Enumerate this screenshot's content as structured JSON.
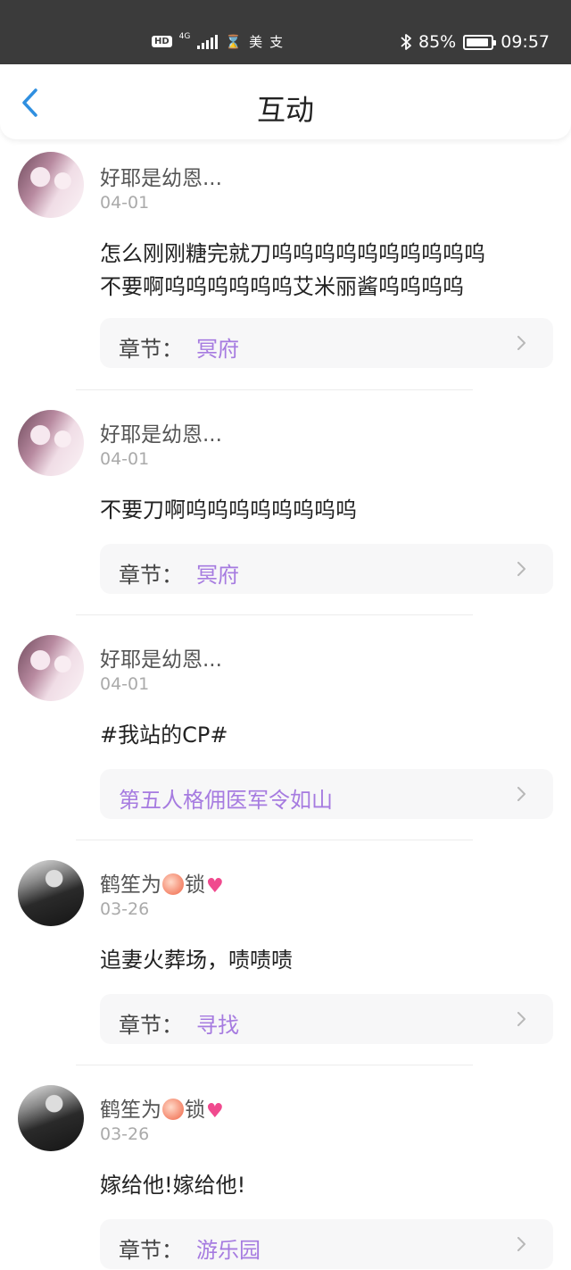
{
  "status_bar": {
    "left_badge": "HD",
    "network": "4G",
    "app_glyph_1": "⌛",
    "app_glyph_2": "美",
    "app_glyph_3": "支",
    "bluetooth": "✱",
    "battery_text": "85%",
    "time": "09:57",
    "battery_level": 0.85
  },
  "header": {
    "title": "互动",
    "back_icon": "chevron-left-icon"
  },
  "comments": [
    {
      "username": "好耶是幼恩...",
      "date": "04-01",
      "text_lines": [
        "怎么刚刚糖完就刀呜呜呜呜呜呜呜呜呜呜",
        "不要啊呜呜呜呜呜呜艾米丽酱呜呜呜呜"
      ],
      "chapter_label": "章节：",
      "chapter_value": "冥府"
    },
    {
      "username": "好耶是幼恩...",
      "date": "04-01",
      "text_lines": [
        "不要刀啊呜呜呜呜呜呜呜呜"
      ],
      "chapter_label": "章节：",
      "chapter_value": "冥府"
    },
    {
      "username": "好耶是幼恩...",
      "date": "04-01",
      "text_lines": [
        "#我站的CP#"
      ],
      "chapter_label": "",
      "chapter_value": "第五人格佣医军令如山"
    },
    {
      "username": "鹤笙为",
      "username_suffix": "锁",
      "date": "03-26",
      "text_lines": [
        "追妻火葬场，啧啧啧"
      ],
      "chapter_label": "章节：",
      "chapter_value": "寻找"
    },
    {
      "username": "鹤笙为",
      "username_suffix": "锁",
      "date": "03-26",
      "text_lines": [
        "嫁给他!嫁给他!"
      ],
      "chapter_label": "章节：",
      "chapter_value": "游乐园"
    }
  ],
  "colors": {
    "status_bar_bg": "#3b3b3b",
    "accent_purple": "#a67be0",
    "back_arrow_blue": "#2f8fe0"
  },
  "icons": [
    "chevron-left-icon",
    "chevron-right-icon",
    "peach-emoji-icon",
    "heart-emoji-icon",
    "bluetooth-icon",
    "battery-icon",
    "signal-icon"
  ]
}
